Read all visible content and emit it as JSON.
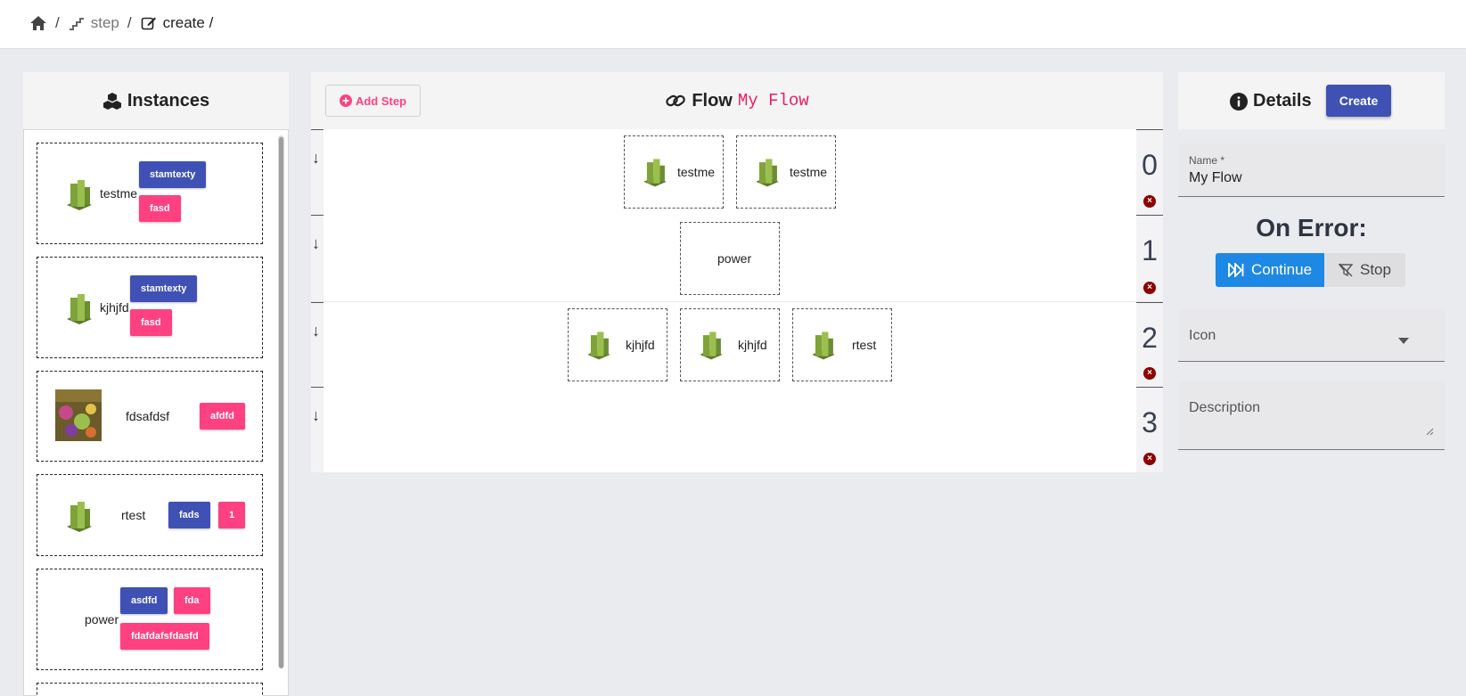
{
  "breadcrumb": {
    "items": [
      {
        "icon": "home-icon",
        "label": ""
      },
      {
        "icon": "stairs-icon",
        "label": "step"
      },
      {
        "icon": "edit-icon",
        "label": "create /"
      }
    ]
  },
  "instances": {
    "title": "Instances",
    "icon": "cubes-icon",
    "cards": [
      {
        "name": "testme",
        "tags": [
          {
            "label": "stamtexty",
            "color": "#3f51b5"
          },
          {
            "label": "fasd",
            "color": "#ff4081"
          }
        ]
      },
      {
        "name": "kjhjfd",
        "tags": [
          {
            "label": "stamtexty",
            "color": "#3f51b5"
          },
          {
            "label": "fasd",
            "color": "#ff4081"
          }
        ]
      },
      {
        "name": "fdsafdsf",
        "tags": [
          {
            "label": "afdfd",
            "color": "#ff4081"
          }
        ]
      },
      {
        "name": "rtest",
        "tags": [
          {
            "label": "fads",
            "color": "#3f51b5"
          },
          {
            "label": "1",
            "color": "#ff4081"
          }
        ]
      },
      {
        "name": "power",
        "tags": [
          {
            "label": "asdfd",
            "color": "#3f51b5"
          },
          {
            "label": "fda",
            "color": "#ff4081"
          },
          {
            "label": "fdafdafsfdasfd",
            "color": "#ff4081"
          }
        ]
      }
    ]
  },
  "flow": {
    "add_step_label": "Add Step",
    "title": "Flow",
    "name": "My Flow",
    "steps": [
      {
        "index": "0",
        "nodes": [
          "testme",
          "testme"
        ]
      },
      {
        "index": "1",
        "nodes": [
          "power"
        ]
      },
      {
        "index": "2",
        "nodes": [
          "kjhjfd",
          "kjhjfd",
          "rtest"
        ]
      },
      {
        "index": "3",
        "nodes": []
      }
    ]
  },
  "details": {
    "title": "Details",
    "create_label": "Create",
    "name_label": "Name *",
    "name_value": "My Flow",
    "on_error_label": "On Error:",
    "continue_label": "Continue",
    "stop_label": "Stop",
    "icon_placeholder": "Icon",
    "description_placeholder": "Description"
  },
  "colors": {
    "primary": "#3f51b5",
    "accent": "#ff4081",
    "continue": "#1e88e5",
    "danger": "#8b0000"
  }
}
